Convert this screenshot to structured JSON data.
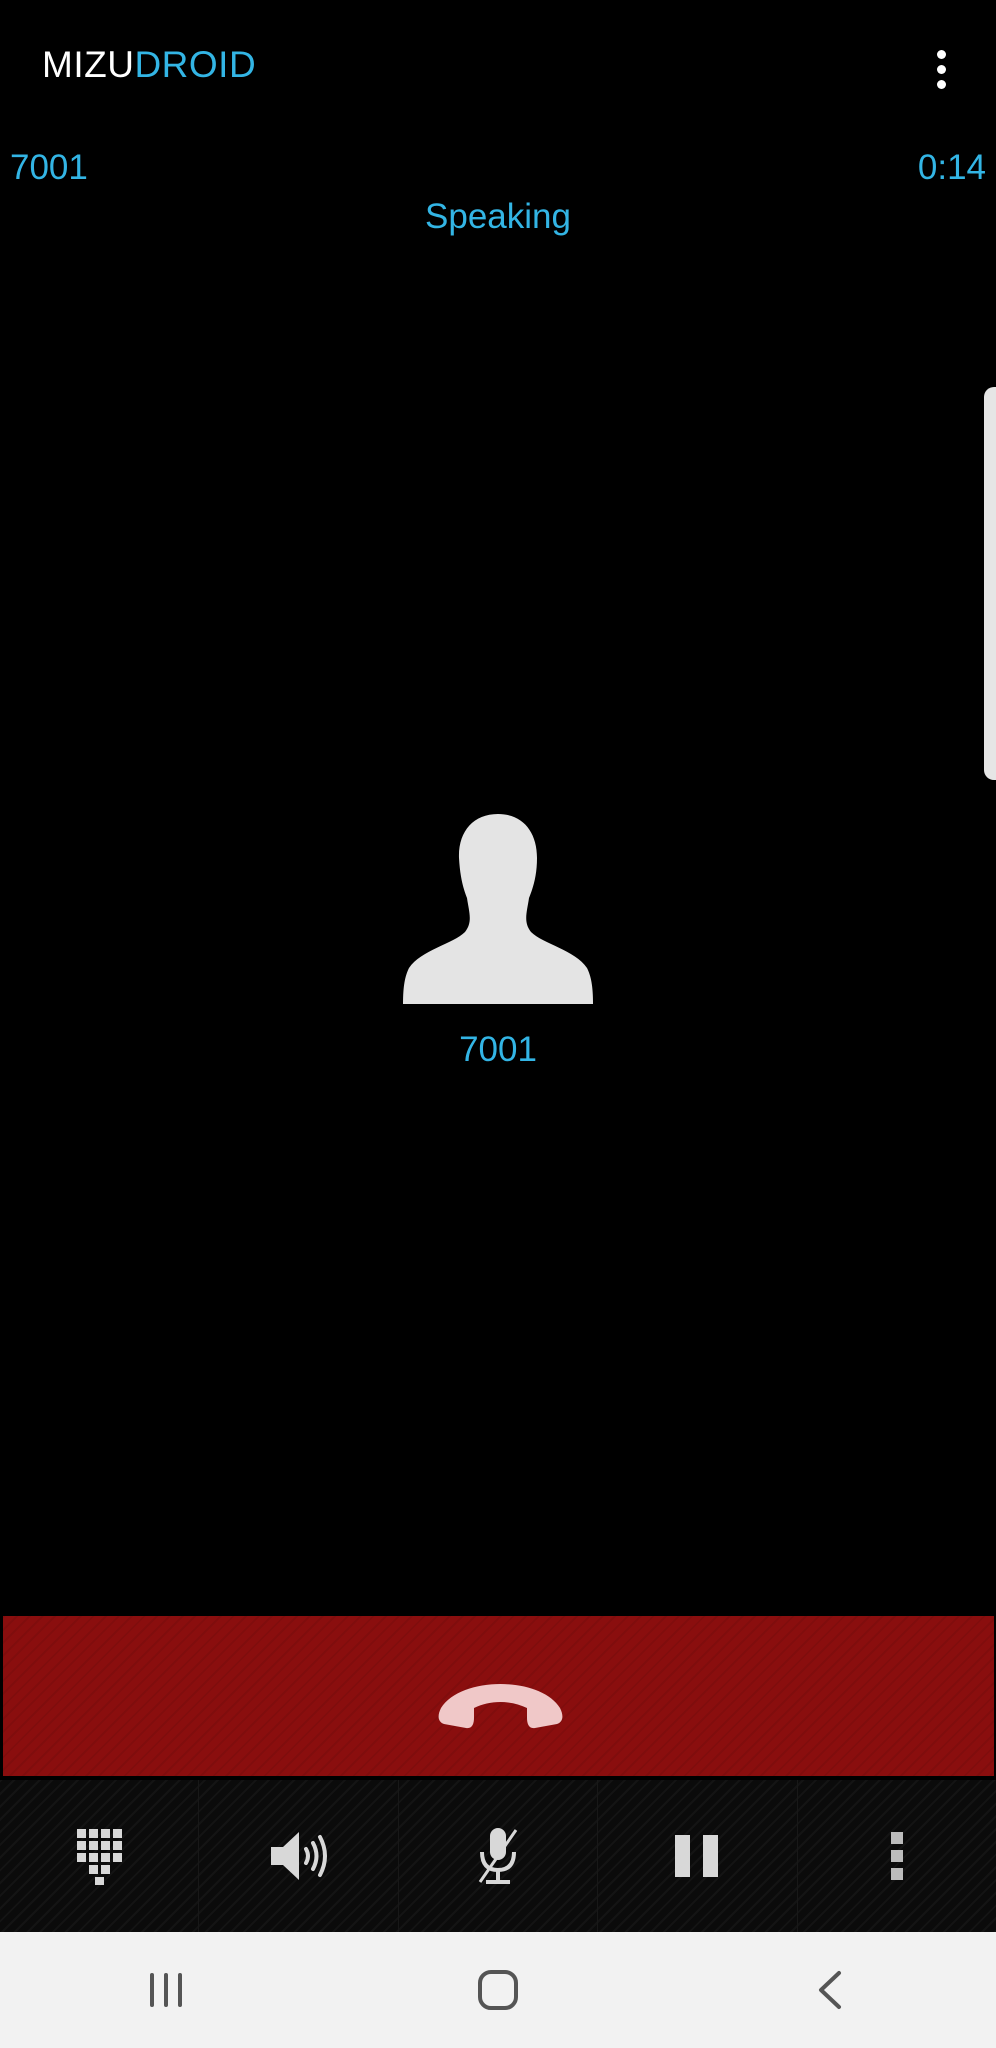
{
  "app": {
    "title_part1": "MIZU",
    "title_part2": "DROID"
  },
  "call": {
    "number": "7001",
    "duration": "0:14",
    "status": "Speaking",
    "contact_name": "7001"
  },
  "toolbar": {
    "items": [
      {
        "icon": "dialpad-icon"
      },
      {
        "icon": "speaker-icon"
      },
      {
        "icon": "microphone-icon"
      },
      {
        "icon": "pause-icon"
      },
      {
        "icon": "more-vertical-icon"
      }
    ]
  },
  "colors": {
    "accent": "#33b5e5",
    "hangup": "#8a0e0e",
    "background": "#000000"
  }
}
